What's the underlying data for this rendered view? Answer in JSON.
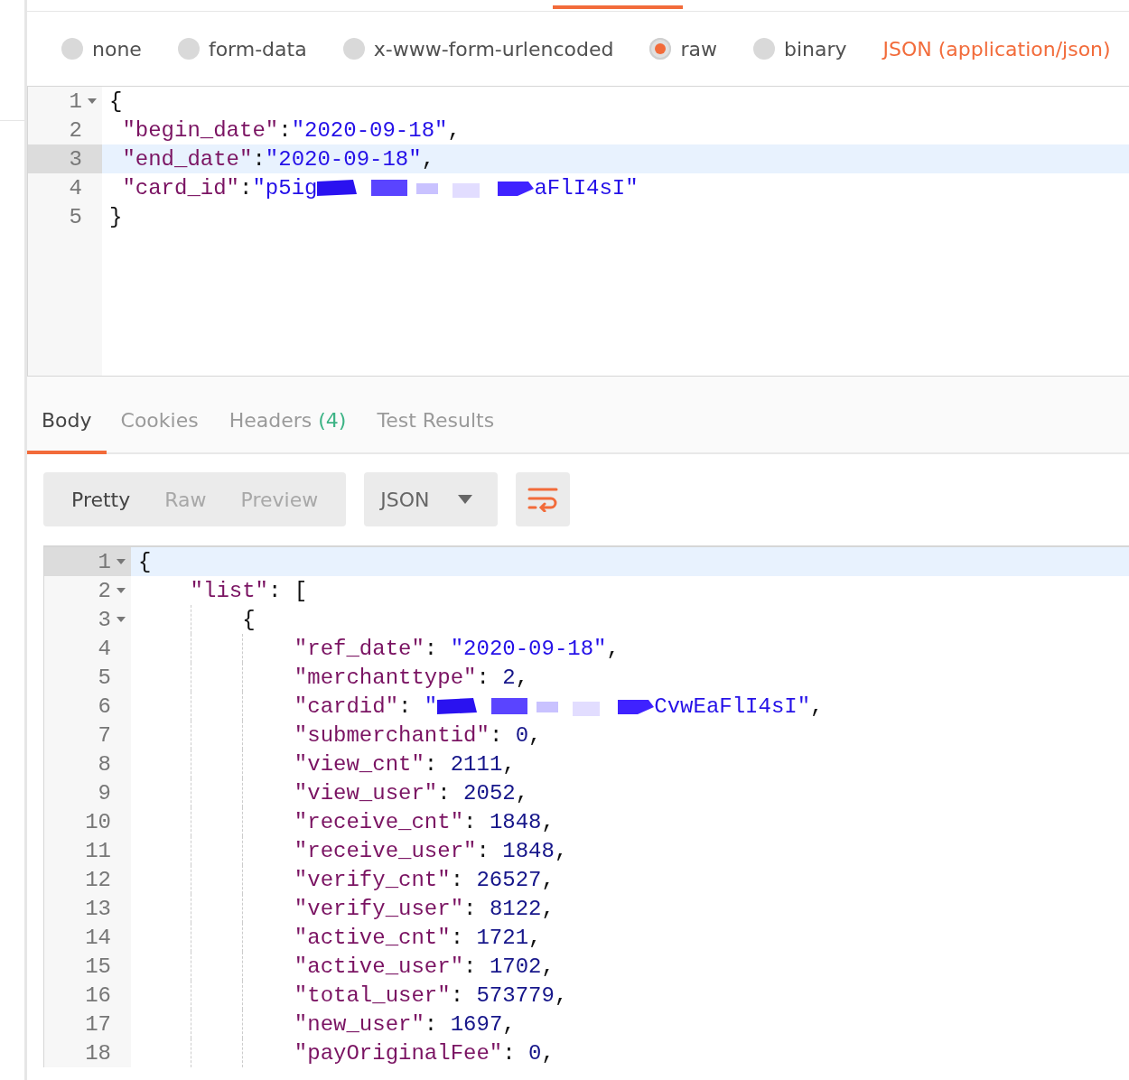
{
  "body_types": [
    {
      "label": "none",
      "selected": false
    },
    {
      "label": "form-data",
      "selected": false
    },
    {
      "label": "x-www-form-urlencoded",
      "selected": false
    },
    {
      "label": "raw",
      "selected": true
    },
    {
      "label": "binary",
      "selected": false
    }
  ],
  "content_type": "JSON (application/json)",
  "request_editor": {
    "lines": [
      {
        "number": "1",
        "foldable": true,
        "active": false,
        "tokens": [
          {
            "kind": "punct",
            "text": "{"
          }
        ]
      },
      {
        "number": "2",
        "foldable": false,
        "active": false,
        "tokens": [
          {
            "kind": "key",
            "text": "\"begin_date\""
          },
          {
            "kind": "punct",
            "text": ":"
          },
          {
            "kind": "string",
            "text": "\"2020-09-18\""
          },
          {
            "kind": "punct",
            "text": ","
          }
        ]
      },
      {
        "number": "3",
        "foldable": false,
        "active": true,
        "tokens": [
          {
            "kind": "key",
            "text": "\"end_date\""
          },
          {
            "kind": "punct",
            "text": ":"
          },
          {
            "kind": "string",
            "text": "\"2020-09-18\""
          },
          {
            "kind": "punct",
            "text": ","
          }
        ]
      },
      {
        "number": "4",
        "foldable": false,
        "active": false,
        "tokens": [
          {
            "kind": "key",
            "text": "\"card_id\""
          },
          {
            "kind": "punct",
            "text": ":"
          },
          {
            "kind": "string",
            "text": "\"p5ig"
          },
          {
            "kind": "redaction"
          },
          {
            "kind": "string",
            "text": "aFlI4sI\""
          }
        ]
      },
      {
        "number": "5",
        "foldable": false,
        "active": false,
        "tokens": [
          {
            "kind": "punct",
            "text": "}"
          }
        ]
      }
    ]
  },
  "response_tabs": [
    {
      "label": "Body",
      "selected": true
    },
    {
      "label": "Cookies",
      "selected": false
    },
    {
      "label": "Headers",
      "count": "(4)",
      "selected": false
    },
    {
      "label": "Test Results",
      "selected": false
    }
  ],
  "view_modes": [
    {
      "label": "Pretty",
      "selected": true
    },
    {
      "label": "Raw",
      "selected": false
    },
    {
      "label": "Preview",
      "selected": false
    }
  ],
  "format": "JSON",
  "response_editor": {
    "lines": [
      {
        "number": "1",
        "foldable": true,
        "active": true,
        "tokens": [
          {
            "kind": "punct",
            "text": "{"
          }
        ]
      },
      {
        "number": "2",
        "foldable": true,
        "active": false,
        "tokens": [
          {
            "kind": "key",
            "text": "\"list\""
          },
          {
            "kind": "punct",
            "text": ": ["
          }
        ]
      },
      {
        "number": "3",
        "foldable": true,
        "active": false,
        "tokens": [
          {
            "kind": "punct",
            "text": "{"
          }
        ]
      },
      {
        "number": "4",
        "foldable": false,
        "active": false,
        "tokens": [
          {
            "kind": "key",
            "text": "\"ref_date\""
          },
          {
            "kind": "punct",
            "text": ": "
          },
          {
            "kind": "string",
            "text": "\"2020-09-18\""
          },
          {
            "kind": "punct",
            "text": ","
          }
        ]
      },
      {
        "number": "5",
        "foldable": false,
        "active": false,
        "tokens": [
          {
            "kind": "key",
            "text": "\"merchanttype\""
          },
          {
            "kind": "punct",
            "text": ": "
          },
          {
            "kind": "number",
            "text": "2"
          },
          {
            "kind": "punct",
            "text": ","
          }
        ]
      },
      {
        "number": "6",
        "foldable": false,
        "active": false,
        "tokens": [
          {
            "kind": "key",
            "text": "\"cardid\""
          },
          {
            "kind": "punct",
            "text": ": "
          },
          {
            "kind": "string",
            "text": "\""
          },
          {
            "kind": "redaction"
          },
          {
            "kind": "string",
            "text": "CvwEaFlI4sI\""
          },
          {
            "kind": "punct",
            "text": ","
          }
        ]
      },
      {
        "number": "7",
        "foldable": false,
        "active": false,
        "tokens": [
          {
            "kind": "key",
            "text": "\"submerchantid\""
          },
          {
            "kind": "punct",
            "text": ": "
          },
          {
            "kind": "number",
            "text": "0"
          },
          {
            "kind": "punct",
            "text": ","
          }
        ]
      },
      {
        "number": "8",
        "foldable": false,
        "active": false,
        "tokens": [
          {
            "kind": "key",
            "text": "\"view_cnt\""
          },
          {
            "kind": "punct",
            "text": ": "
          },
          {
            "kind": "number",
            "text": "2111"
          },
          {
            "kind": "punct",
            "text": ","
          }
        ]
      },
      {
        "number": "9",
        "foldable": false,
        "active": false,
        "tokens": [
          {
            "kind": "key",
            "text": "\"view_user\""
          },
          {
            "kind": "punct",
            "text": ": "
          },
          {
            "kind": "number",
            "text": "2052"
          },
          {
            "kind": "punct",
            "text": ","
          }
        ]
      },
      {
        "number": "10",
        "foldable": false,
        "active": false,
        "tokens": [
          {
            "kind": "key",
            "text": "\"receive_cnt\""
          },
          {
            "kind": "punct",
            "text": ": "
          },
          {
            "kind": "number",
            "text": "1848"
          },
          {
            "kind": "punct",
            "text": ","
          }
        ]
      },
      {
        "number": "11",
        "foldable": false,
        "active": false,
        "tokens": [
          {
            "kind": "key",
            "text": "\"receive_user\""
          },
          {
            "kind": "punct",
            "text": ": "
          },
          {
            "kind": "number",
            "text": "1848"
          },
          {
            "kind": "punct",
            "text": ","
          }
        ]
      },
      {
        "number": "12",
        "foldable": false,
        "active": false,
        "tokens": [
          {
            "kind": "key",
            "text": "\"verify_cnt\""
          },
          {
            "kind": "punct",
            "text": ": "
          },
          {
            "kind": "number",
            "text": "26527"
          },
          {
            "kind": "punct",
            "text": ","
          }
        ]
      },
      {
        "number": "13",
        "foldable": false,
        "active": false,
        "tokens": [
          {
            "kind": "key",
            "text": "\"verify_user\""
          },
          {
            "kind": "punct",
            "text": ": "
          },
          {
            "kind": "number",
            "text": "8122"
          },
          {
            "kind": "punct",
            "text": ","
          }
        ]
      },
      {
        "number": "14",
        "foldable": false,
        "active": false,
        "tokens": [
          {
            "kind": "key",
            "text": "\"active_cnt\""
          },
          {
            "kind": "punct",
            "text": ": "
          },
          {
            "kind": "number",
            "text": "1721"
          },
          {
            "kind": "punct",
            "text": ","
          }
        ]
      },
      {
        "number": "15",
        "foldable": false,
        "active": false,
        "tokens": [
          {
            "kind": "key",
            "text": "\"active_user\""
          },
          {
            "kind": "punct",
            "text": ": "
          },
          {
            "kind": "number",
            "text": "1702"
          },
          {
            "kind": "punct",
            "text": ","
          }
        ]
      },
      {
        "number": "16",
        "foldable": false,
        "active": false,
        "tokens": [
          {
            "kind": "key",
            "text": "\"total_user\""
          },
          {
            "kind": "punct",
            "text": ": "
          },
          {
            "kind": "number",
            "text": "573779"
          },
          {
            "kind": "punct",
            "text": ","
          }
        ]
      },
      {
        "number": "17",
        "foldable": false,
        "active": false,
        "tokens": [
          {
            "kind": "key",
            "text": "\"new_user\""
          },
          {
            "kind": "punct",
            "text": ": "
          },
          {
            "kind": "number",
            "text": "1697"
          },
          {
            "kind": "punct",
            "text": ","
          }
        ]
      },
      {
        "number": "18",
        "foldable": false,
        "active": false,
        "tokens": [
          {
            "kind": "key",
            "text": "\"payOriginalFee\""
          },
          {
            "kind": "punct",
            "text": ": "
          },
          {
            "kind": "number",
            "text": "0"
          },
          {
            "kind": "punct",
            "text": ","
          }
        ]
      }
    ]
  }
}
